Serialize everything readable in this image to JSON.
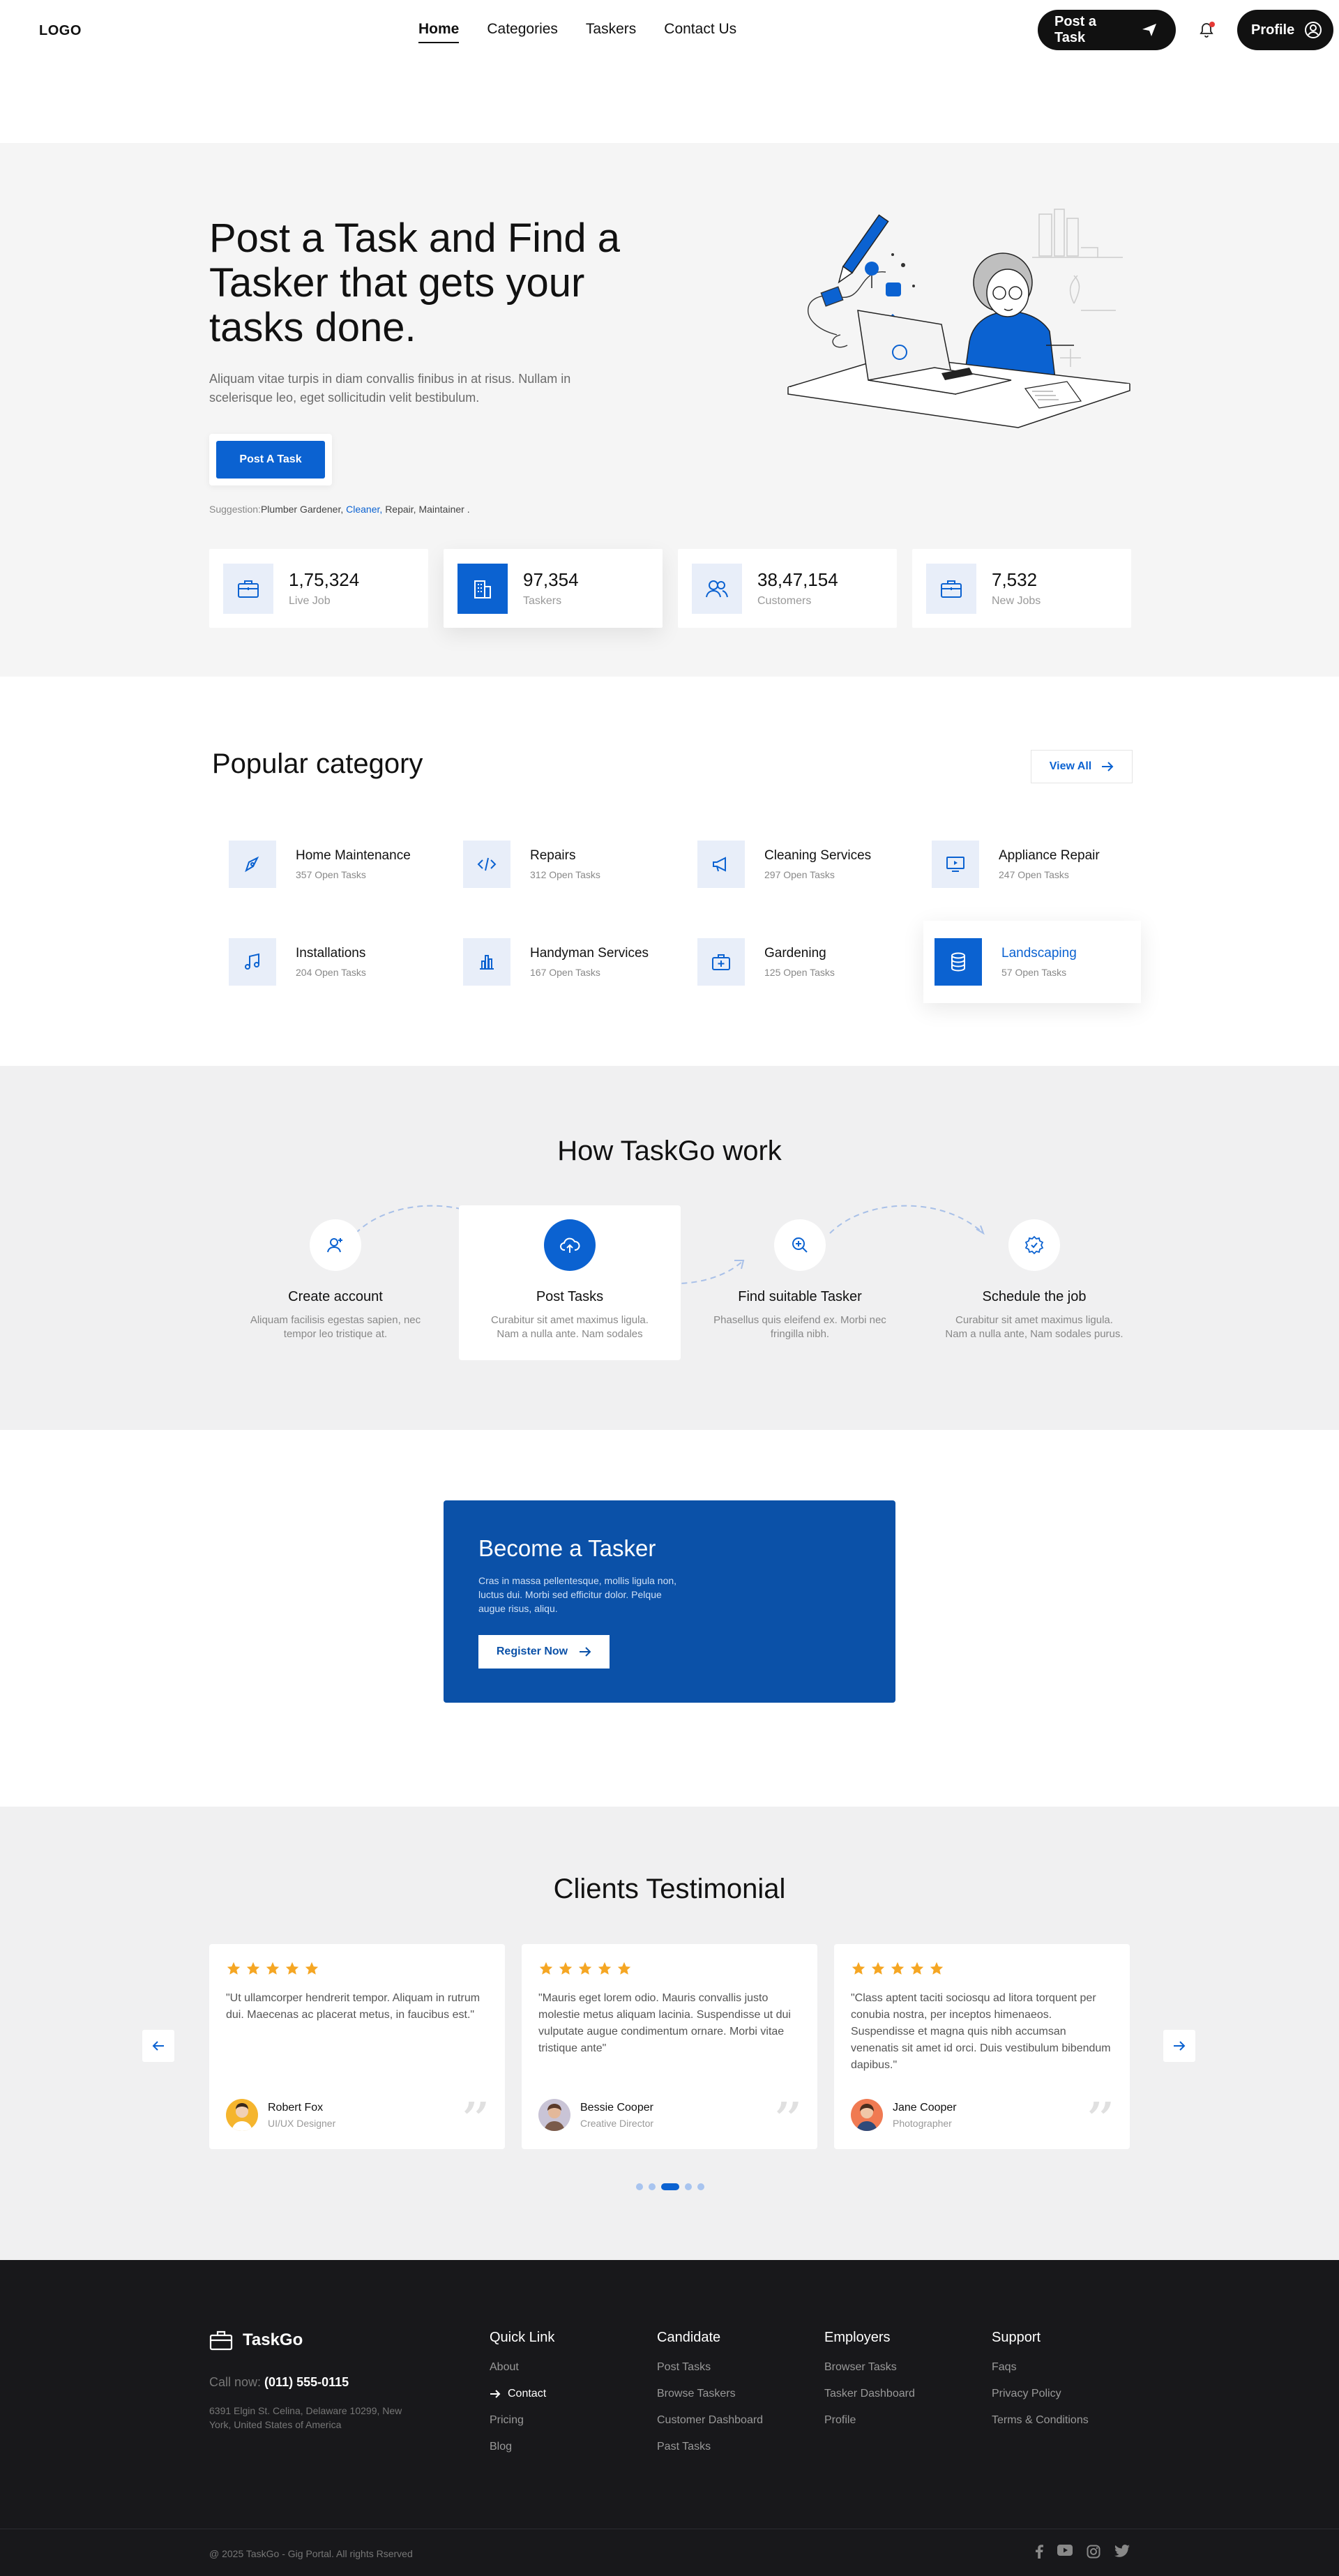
{
  "nav": {
    "logo": "LOGO",
    "links": [
      "Home",
      "Categories",
      "Taskers",
      "Contact Us"
    ],
    "post_task": "Post a Task",
    "profile": "Profile"
  },
  "hero": {
    "title": "Post a Task and Find a Tasker that gets your tasks done.",
    "description": "Aliquam vitae turpis in diam convallis finibus in at risus. Nullam in scelerisque leo, eget sollicitudin velit bestibulum.",
    "button": "Post A Task",
    "suggestion_label": "Suggestion:",
    "suggestion_items": [
      "Plumber Gardener,",
      "Cleaner,",
      "Repair,",
      "Maintainer ."
    ],
    "stats": [
      {
        "value": "1,75,324",
        "label": "Live Job"
      },
      {
        "value": "97,354",
        "label": "Taskers"
      },
      {
        "value": "38,47,154",
        "label": "Customers"
      },
      {
        "value": "7,532",
        "label": "New Jobs"
      }
    ]
  },
  "category": {
    "title": "Popular category",
    "view_all": "View All",
    "items": [
      {
        "name": "Home Maintenance",
        "count": "357 Open Tasks"
      },
      {
        "name": "Repairs",
        "count": "312 Open Tasks"
      },
      {
        "name": "Cleaning Services",
        "count": "297 Open Tasks"
      },
      {
        "name": "Appliance Repair",
        "count": "247 Open Tasks"
      },
      {
        "name": "Installations",
        "count": "204 Open Tasks"
      },
      {
        "name": "Handyman Services",
        "count": "167 Open Tasks"
      },
      {
        "name": "Gardening",
        "count": "125 Open Tasks"
      },
      {
        "name": "Landscaping",
        "count": "57 Open Tasks"
      }
    ]
  },
  "how": {
    "title": "How TaskGo work",
    "steps": [
      {
        "title": "Create account",
        "desc": "Aliquam facilisis egestas sapien, nec tempor leo tristique at."
      },
      {
        "title": "Post Tasks",
        "desc": "Curabitur sit amet maximus ligula. Nam a nulla ante. Nam sodales"
      },
      {
        "title": "Find suitable Tasker",
        "desc": "Phasellus quis eleifend ex. Morbi nec fringilla nibh."
      },
      {
        "title": "Schedule the job",
        "desc": "Curabitur sit amet maximus ligula. Nam a nulla ante, Nam sodales purus."
      }
    ]
  },
  "become": {
    "title": "Become a Tasker",
    "desc": "Cras in massa pellentesque, mollis ligula non, luctus dui. Morbi sed efficitur dolor. Pelque augue risus, aliqu.",
    "button": "Register Now"
  },
  "testimonial": {
    "title": "Clients Testimonial",
    "cards": [
      {
        "quote": "\"Ut ullamcorper hendrerit tempor. Aliquam in rutrum dui. Maecenas ac placerat metus, in faucibus est.\"",
        "name": "Robert Fox",
        "role": "UI/UX Designer"
      },
      {
        "quote": "\"Mauris eget lorem odio. Mauris convallis justo molestie metus aliquam lacinia. Suspendisse ut dui vulputate augue condimentum ornare. Morbi vitae tristique ante\"",
        "name": "Bessie Cooper",
        "role": "Creative Director"
      },
      {
        "quote": "\"Class aptent taciti sociosqu ad litora torquent per conubia nostra, per inceptos himenaeos. Suspendisse et magna quis nibh accumsan venenatis sit amet id orci. Duis vestibulum bibendum dapibus.\"",
        "name": "Jane Cooper",
        "role": "Photographer"
      }
    ]
  },
  "footer": {
    "brand": "TaskGo",
    "call_label": "Call now:",
    "phone": "(011) 555-0115",
    "address": "6391 Elgin St. Celina, Delaware 10299, New York, United States of America",
    "columns": [
      {
        "title": "Quick Link",
        "items": [
          "About",
          "Contact",
          "Pricing",
          "Blog"
        ]
      },
      {
        "title": "Candidate",
        "items": [
          "Post Tasks",
          "Browse Taskers",
          "Customer Dashboard",
          "Past Tasks"
        ]
      },
      {
        "title": "Employers",
        "items": [
          "Browser Tasks",
          "Tasker Dashboard",
          "Profile"
        ]
      },
      {
        "title": "Support",
        "items": [
          "Faqs",
          "Privacy Policy",
          "Terms & Conditions"
        ]
      }
    ],
    "copyright": "@ 2025 TaskGo - Gig Portal. All rights Rserved"
  },
  "colors": {
    "accent": "#0b62d1",
    "banner": "#0b51a8",
    "footer": "#18181b",
    "star": "#f5a623"
  }
}
